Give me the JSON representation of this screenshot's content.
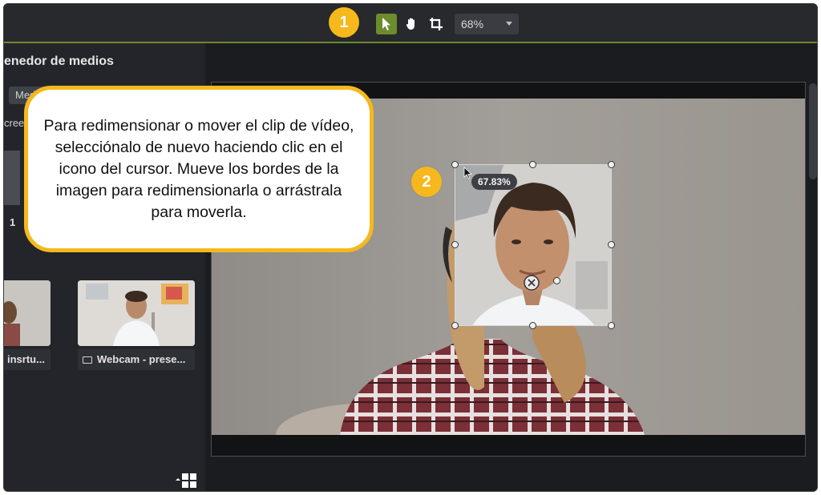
{
  "toolbar": {
    "tools": [
      "cursor-icon",
      "hand-icon",
      "crop-icon"
    ],
    "zoom_value": "68%",
    "accent_color": "#6b8d2e"
  },
  "steps": {
    "step1": "1",
    "step2": "2",
    "color": "#f6b81c"
  },
  "media_panel": {
    "title": "enedor de medios",
    "tab_label": "Medios",
    "partial_text": "cree",
    "count_label": "1",
    "thumbnails": [
      {
        "label": "insrtu..."
      },
      {
        "label": "Webcam - prese..."
      }
    ]
  },
  "canvas": {
    "clip_scale": "67.83%"
  },
  "callout": {
    "text": "Para redimensionar o mover el clip de vídeo, selecciónalo de nuevo haciendo clic en el icono del cursor. Mueve los bordes de la imagen para redimensionarla o arrástrala para moverla."
  }
}
